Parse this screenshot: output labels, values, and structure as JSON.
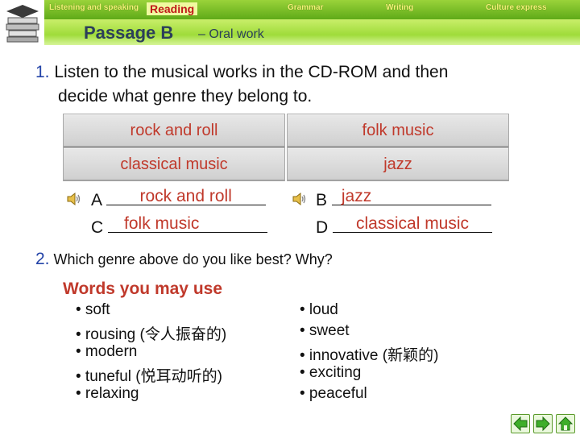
{
  "header": {
    "tabs": [
      {
        "label": "Listening and speaking"
      },
      {
        "label": "Reading"
      },
      {
        "label": "Grammar"
      },
      {
        "label": "Writing"
      },
      {
        "label": "Culture express"
      }
    ],
    "passage_title": "Passage B",
    "passage_subtitle": "– Oral work",
    "active_tab_color": "#c01818",
    "bar_color": "#7cc12a"
  },
  "question1": {
    "number": "1.",
    "line1": "Listen to the musical works in the CD-ROM and then",
    "line2": "decide what genre they belong to."
  },
  "genres": [
    "rock and roll",
    "folk music",
    "classical music",
    "jazz"
  ],
  "answers": [
    {
      "letter": "A",
      "value": "rock and roll"
    },
    {
      "letter": "B",
      "value": "jazz"
    },
    {
      "letter": "C",
      "value": "folk music"
    },
    {
      "letter": "D",
      "value": "classical music"
    }
  ],
  "question2": {
    "number": "2.",
    "text": "Which genre above do you like best? Why?"
  },
  "words": {
    "title": "Words you may use",
    "left": [
      "• soft",
      "• rousing (令人振奋的)",
      "• modern",
      "• tuneful (悦耳动听的)",
      "• relaxing"
    ],
    "right": [
      "• loud",
      "• sweet",
      "• innovative (新颖的)",
      "• exciting",
      "• peaceful"
    ]
  },
  "accent_color": "#c0392b",
  "icons": [
    "books-logo-icon",
    "speaker-icon",
    "back-arrow-icon",
    "forward-arrow-icon",
    "home-icon"
  ]
}
